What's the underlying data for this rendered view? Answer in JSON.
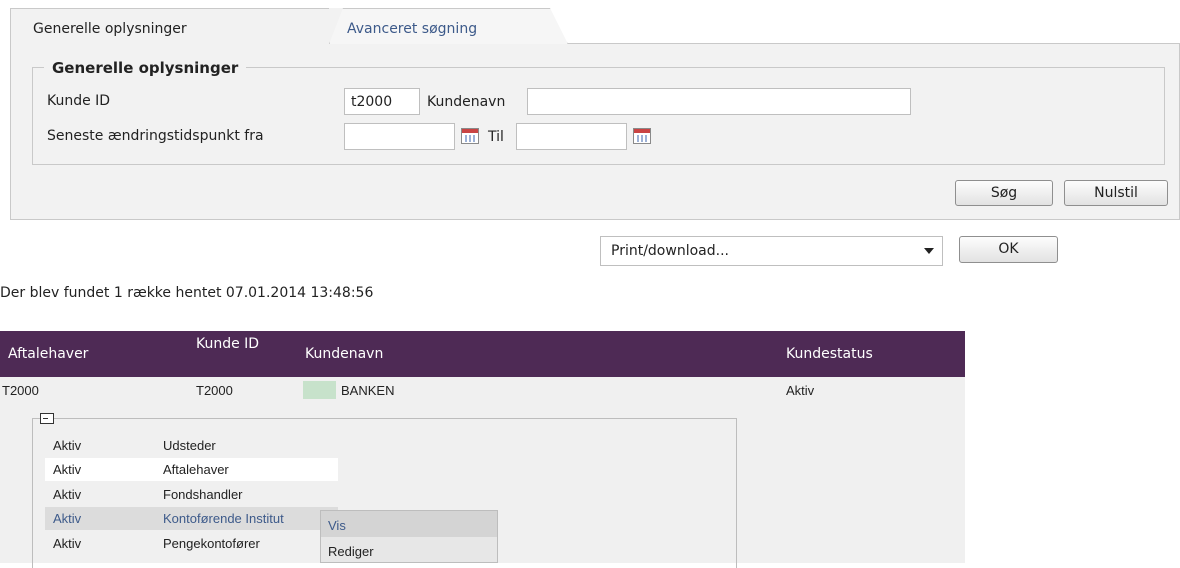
{
  "tabs": [
    {
      "label": "Generelle oplysninger",
      "active": true
    },
    {
      "label": "Avanceret søgning",
      "active": false
    }
  ],
  "search": {
    "legend": "Generelle oplysninger",
    "customer_id_label": "Kunde ID",
    "customer_id_value": "t2000",
    "customer_name_label": "Kundenavn",
    "customer_name_value": "",
    "changed_from_label": "Seneste ændringstidspunkt fra",
    "changed_from_value": "",
    "changed_to_label": "Til",
    "changed_to_value": "",
    "search_button": "Søg",
    "reset_button": "Nulstil"
  },
  "print": {
    "selected": "Print/download...",
    "ok_button": "OK"
  },
  "result_text": "Der blev fundet 1 række hentet 07.01.2014 13:48:56",
  "table": {
    "headers": [
      "Aftalehaver",
      "Kunde ID",
      "Kundenavn",
      "Kundestatus"
    ],
    "row": {
      "agreement_holder": "T2000",
      "customer_id": "T2000",
      "customer_name": "BANKEN",
      "status": "Aktiv"
    },
    "roles": [
      {
        "status": "Aktiv",
        "role": "Udsteder"
      },
      {
        "status": "Aktiv",
        "role": "Aftalehaver"
      },
      {
        "status": "Aktiv",
        "role": "Fondshandler"
      },
      {
        "status": "Aktiv",
        "role": "Kontoførende Institut"
      },
      {
        "status": "Aktiv",
        "role": "Pengekontofører"
      }
    ]
  },
  "context_menu": {
    "items": [
      "Vis",
      "Rediger"
    ]
  },
  "colors": {
    "header_bg": "#4e2a55",
    "status_swatch": "#c7e2cb",
    "link": "#3d5a8a"
  }
}
